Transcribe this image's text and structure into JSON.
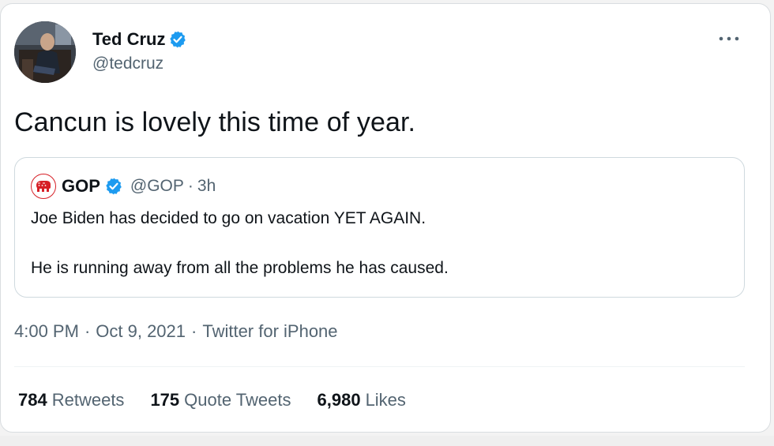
{
  "tweet": {
    "author": {
      "name": "Ted Cruz",
      "handle": "@tedcruz",
      "verified": true
    },
    "text": "Cancun is lovely this time of year.",
    "quoted": {
      "name": "GOP",
      "handle": "@GOP",
      "separator": "·",
      "time": "3h",
      "verified": true,
      "line1": "Joe Biden has decided to go on vacation YET AGAIN.",
      "line2": "He is running away from all the problems he has caused."
    },
    "meta": {
      "time": "4:00 PM",
      "sep1": "·",
      "date": "Oct 9, 2021",
      "sep2": "·",
      "source": "Twitter for iPhone"
    },
    "stats": {
      "retweets": {
        "count": "784",
        "label": "Retweets"
      },
      "quotes": {
        "count": "175",
        "label": "Quote Tweets"
      },
      "likes": {
        "count": "6,980",
        "label": "Likes"
      }
    }
  },
  "colors": {
    "verified_blue": "#1d9bf0",
    "text_primary": "#0f1419",
    "text_secondary": "#536471",
    "gop_red": "#d61f26"
  },
  "icons": {
    "verified": "verified-badge-icon",
    "more": "more-options-icon",
    "gop_logo": "gop-elephant-icon"
  }
}
